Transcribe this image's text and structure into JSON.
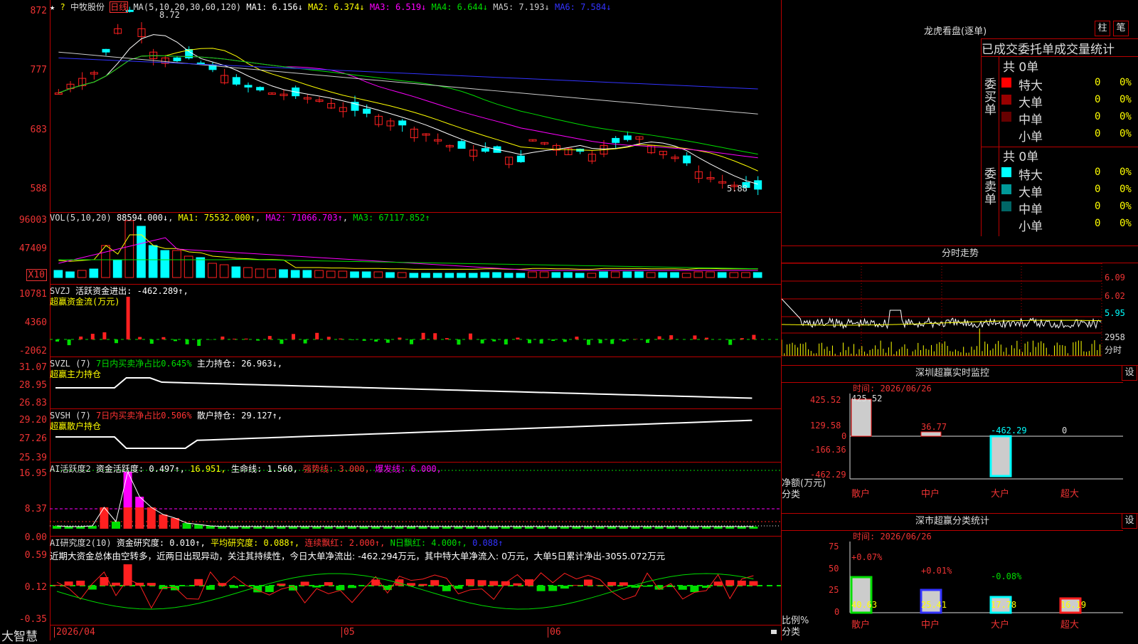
{
  "colors": {
    "up": "#ff2020",
    "down": "#00ffff",
    "grid": "#b00000",
    "yellow": "#ffff00",
    "magenta": "#ff00ff",
    "green": "#00dd00",
    "blue": "#3333ff",
    "white": "#ffffff"
  },
  "kline": {
    "name": "中牧股份",
    "period": "日线",
    "ma_label": "MA(5,10,20,30,60,120)",
    "ma1": "MA1: 6.156↓",
    "ma2": "MA2: 6.374↓",
    "ma3": "MA3: 6.519↓",
    "ma4": "MA4: 6.644↓",
    "ma5": "MA5: 7.193↓",
    "ma6": "MA6: 7.584↓",
    "high_mark": "8.72",
    "low_mark": "5.88",
    "y_ticks": [
      "872",
      "777",
      "683",
      "588"
    ]
  },
  "vol": {
    "label": "VOL(5,10,20)",
    "value": "88594.000↓",
    "ma1": "MA1: 75532.000↑",
    "ma2": "MA2: 71066.703↑",
    "ma3": "MA3: 67117.852↑",
    "y_ticks": [
      "96003",
      "47409"
    ],
    "unit": "X10"
  },
  "svzj": {
    "label": "SVZJ",
    "desc": "活跃资金进出: -462.289↑,",
    "sub": "超赢资金流(万元)",
    "y_ticks": [
      "10781",
      "4360",
      "-2062"
    ]
  },
  "svzl": {
    "label": "SVZL (7)",
    "desc1": "7日内买卖净占比0.645%",
    "desc2": "主力持仓: 26.963↓,",
    "sub": "超赢主力持仓",
    "y_ticks": [
      "31.07",
      "28.95",
      "26.83"
    ]
  },
  "svsh": {
    "label": "SVSH (7)",
    "desc1": "7日内买卖净占比0.506%",
    "desc2": "散户持仓: 29.127↑,",
    "sub": "超赢散户持仓",
    "y_ticks": [
      "29.20",
      "27.26",
      "25.39"
    ]
  },
  "ai1": {
    "label": "AI活跃度2",
    "v1": "资金活跃度: 0.497↑,",
    "v2": "16.951,",
    "v3": "生命线: 1.560,",
    "v4": "强势线: 3.000,",
    "v5": "爆发线: 6.000,",
    "y_ticks": [
      "16.95",
      "8.37",
      "0.00"
    ]
  },
  "ai2": {
    "label": "AI研究度2(10)",
    "v1": "资金研究度: 0.010↑,",
    "v2": "平均研究度: 0.088↑,",
    "v3": "连续飘红: 2.000↑,",
    "v4": "N日飘红: 4.000↑,",
    "v5": "0.088↑",
    "note": "近期大资金总体由空转多，近两日出现异动，关注其持续性，今日大单净流出: -462.294万元，其中特大单净流入: 0万元，大单5日累计净出-3055.072万元",
    "y_ticks": [
      "0.59",
      "0.12",
      "-0.35"
    ]
  },
  "bottom": {
    "brand": "大智慧",
    "dates": [
      "2026/04",
      "05",
      "06"
    ]
  },
  "lhb": {
    "title": "龙虎看盘(逐单)",
    "btn1": "柱",
    "btn2": "笔",
    "header": "已成交委托单成交量统计",
    "buy_side": "委买单",
    "sell_side": "委卖单",
    "buy_total": "共 0单",
    "sell_total": "共 0单",
    "buy_rows": [
      {
        "name": "特大",
        "v": "0",
        "p": "0%",
        "c": "#ff0000"
      },
      {
        "name": "大单",
        "v": "0",
        "p": "0%",
        "c": "#990000"
      },
      {
        "name": "中单",
        "v": "0",
        "p": "0%",
        "c": "#660000"
      },
      {
        "name": "小单",
        "v": "0",
        "p": "0%",
        "c": "#000000"
      }
    ],
    "sell_rows": [
      {
        "name": "特大",
        "v": "0",
        "p": "0%",
        "c": "#00ffff"
      },
      {
        "name": "大单",
        "v": "0",
        "p": "0%",
        "c": "#009999"
      },
      {
        "name": "中单",
        "v": "0",
        "p": "0%",
        "c": "#006666"
      },
      {
        "name": "小单",
        "v": "0",
        "p": "0%",
        "c": "#000000"
      }
    ]
  },
  "fenshi": {
    "title": "分时走势",
    "y_ticks": [
      "6.09",
      "6.02",
      "5.95"
    ],
    "vol_tick": "2958",
    "vol_unit": "分时"
  },
  "sz_monitor": {
    "title": "深圳超赢实时监控",
    "btn": "设",
    "time": "时间: 2026/06/26",
    "y_ticks": [
      "425.52",
      "129.58",
      "0",
      "-166.36",
      "-462.29"
    ],
    "ylabel": "净额(万元)",
    "xlabel": "分类",
    "cats": [
      "散户",
      "中户",
      "大户",
      "超大"
    ],
    "values": [
      "425.52",
      "36.77",
      "-462.29",
      "0"
    ]
  },
  "sz_class": {
    "title": "深市超赢分类统计",
    "btn": "设",
    "time": "时间: 2026/06/26",
    "y_ticks": [
      "75",
      "50",
      "25",
      "0"
    ],
    "ylabel": "比例%",
    "xlabel": "分类",
    "cats": [
      "散户",
      "中户",
      "大户",
      "超大"
    ],
    "values": [
      "40.63",
      "25.41",
      "17.78",
      "16.19"
    ],
    "deltas": [
      "+0.07%",
      "+0.01%",
      "-0.08%",
      ""
    ]
  }
}
